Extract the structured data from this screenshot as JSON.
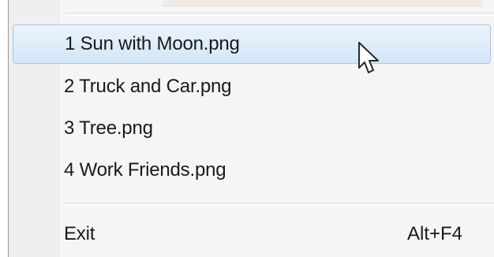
{
  "menu": {
    "recent_files": [
      {
        "label": "1 Sun with Moon.png",
        "highlighted": true
      },
      {
        "label": "2 Truck and Car.png",
        "highlighted": false
      },
      {
        "label": "3 Tree.png",
        "highlighted": false
      },
      {
        "label": "4 Work Friends.png",
        "highlighted": false
      }
    ],
    "exit": {
      "label": "Exit",
      "shortcut": "Alt+F4"
    }
  },
  "colors": {
    "highlight_border": "#a8c8e8",
    "highlight_fill": "#d4e6f7",
    "menu_background": "#f5f5f5"
  },
  "icons": {
    "pointer": "mouse-pointer-icon"
  }
}
